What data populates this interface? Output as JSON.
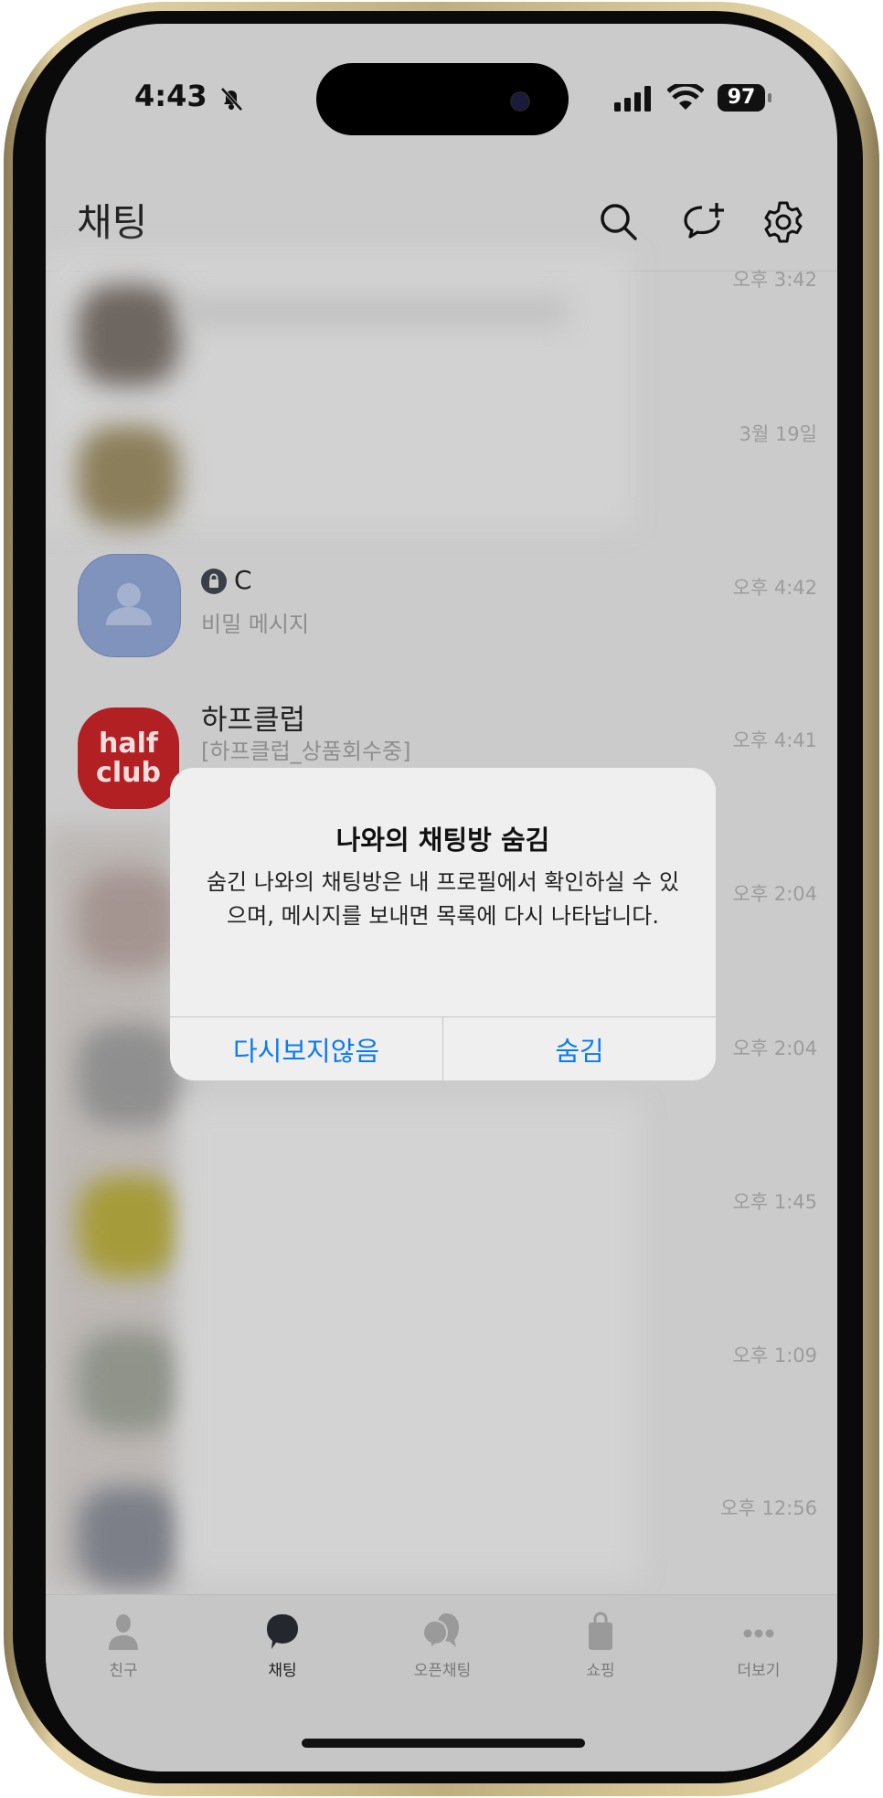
{
  "status_bar": {
    "time": "4:43",
    "battery": "97",
    "icons": [
      "bell-slash-icon",
      "signal-icon",
      "wifi-icon",
      "battery-icon"
    ]
  },
  "header": {
    "title": "채팅",
    "icons": [
      "search-icon",
      "new-chat-icon",
      "gear-icon"
    ]
  },
  "chats": [
    {
      "name": "",
      "preview": "",
      "time": "오후 3:42",
      "blurred": true
    },
    {
      "name": "",
      "preview": "",
      "time": "3월 19일",
      "blurred": true
    },
    {
      "name": "C",
      "preview": "비밀 메시지",
      "time": "오후 4:42",
      "locked": true,
      "avatar_color": "#7f93bd"
    },
    {
      "name": "하프클럽",
      "preview": "[하프클럽_상품회수중]",
      "time": "오후 4:41",
      "avatar_text": [
        "half",
        "club"
      ],
      "avatar_color": "#b32024"
    },
    {
      "name": "",
      "preview": "",
      "time": "오후 2:04",
      "blurred": true
    },
    {
      "name": "",
      "preview": "",
      "time": "오후 2:04",
      "blurred": true
    },
    {
      "name": "",
      "preview": "",
      "time": "오후 1:45",
      "blurred": true
    },
    {
      "name": "",
      "preview": "",
      "time": "오후 1:09",
      "blurred": true
    },
    {
      "name": "",
      "preview": "",
      "time": "오후 12:56",
      "blurred": true
    }
  ],
  "dialog": {
    "title": "나와의 채팅방 숨김",
    "message": "숨긴 나와의 채팅방은 내 프로필에서 확인하실 수 있으며, 메시지를 보내면 목록에 다시 나타납니다.",
    "buttons": [
      "다시보지않음",
      "숨김"
    ],
    "accent": "#0a7cf0"
  },
  "tabs": [
    {
      "label": "친구",
      "icon": "person-icon"
    },
    {
      "label": "채팅",
      "icon": "chat-bubble-icon",
      "active": true
    },
    {
      "label": "오픈채팅",
      "icon": "open-chat-icon"
    },
    {
      "label": "쇼핑",
      "icon": "shopping-bag-icon"
    },
    {
      "label": "더보기",
      "icon": "more-dots-icon"
    }
  ]
}
